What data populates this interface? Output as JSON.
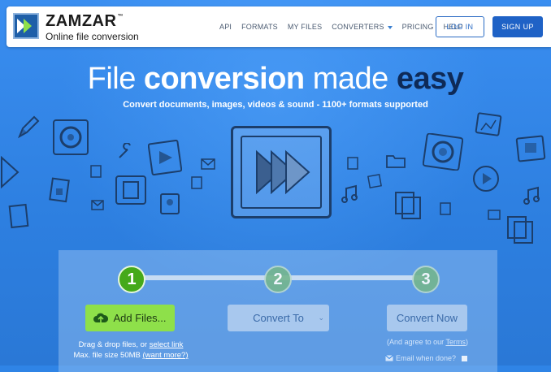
{
  "brand": {
    "name": "ZAMZAR",
    "trademark": "™",
    "tagline": "Online file conversion"
  },
  "nav": {
    "links": [
      "API",
      "FORMATS",
      "MY FILES",
      "CONVERTERS",
      "PRICING",
      "HELP"
    ],
    "login_label": "LOG IN",
    "signup_label": "SIGN UP"
  },
  "hero": {
    "title_part1": "File",
    "title_part2": "conversion",
    "title_part3": "made",
    "title_part4": "easy",
    "subtitle": "Convert documents, images, videos & sound - 1100+ formats supported"
  },
  "steps": {
    "step1": "1",
    "step2": "2",
    "step3": "3"
  },
  "actions": {
    "add_files_label": "Add Files...",
    "convert_to_label": "Convert To",
    "convert_now_label": "Convert Now"
  },
  "upload": {
    "drag_text": "Drag & drop files, or",
    "select_link": "select link",
    "max_size_text": "Max. file size 50MB",
    "want_more": "(want more?)"
  },
  "terms": {
    "agree_prefix": "(And agree to our",
    "terms_link": "Terms",
    "agree_suffix": ")",
    "email_label": "Email when done?"
  },
  "colors": {
    "background": "#2f84e6",
    "accent_green": "#8ee04a",
    "step_active": "#45a91a",
    "dark_navy": "#0e2a57",
    "signup_blue": "#1f62c6"
  }
}
